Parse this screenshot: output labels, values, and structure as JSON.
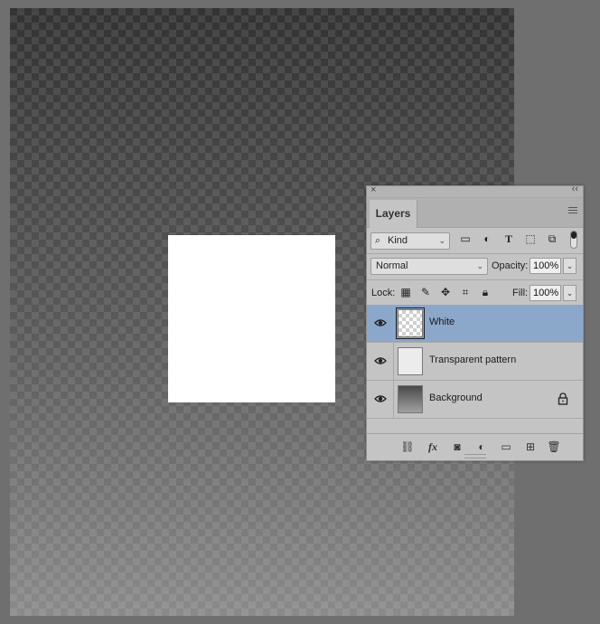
{
  "panel": {
    "tab_label": "Layers",
    "filter": {
      "kind_label": "Kind"
    },
    "blend_mode": "Normal",
    "opacity_label": "Opacity:",
    "opacity_value": "100%",
    "lock_label": "Lock:",
    "fill_label": "Fill:",
    "fill_value": "100%",
    "layers": [
      {
        "name": "White",
        "selected": true,
        "visible": true,
        "thumbnail": "transparent-checker",
        "locked": false
      },
      {
        "name": "Transparent pattern",
        "selected": false,
        "visible": true,
        "thumbnail": "light-gray",
        "locked": false
      },
      {
        "name": "Background",
        "selected": false,
        "visible": true,
        "thumbnail": "dark-gradient",
        "locked": true
      }
    ],
    "footer_icons": [
      "link-icon",
      "fx-icon",
      "mask-icon",
      "adjustment-icon",
      "folder-icon",
      "new-layer-icon",
      "trash-icon"
    ]
  },
  "colors": {
    "selection_highlight": "#8ba7ca",
    "panel_bg": "#c4c4c4",
    "workspace_bg": "#6f6f6f"
  }
}
